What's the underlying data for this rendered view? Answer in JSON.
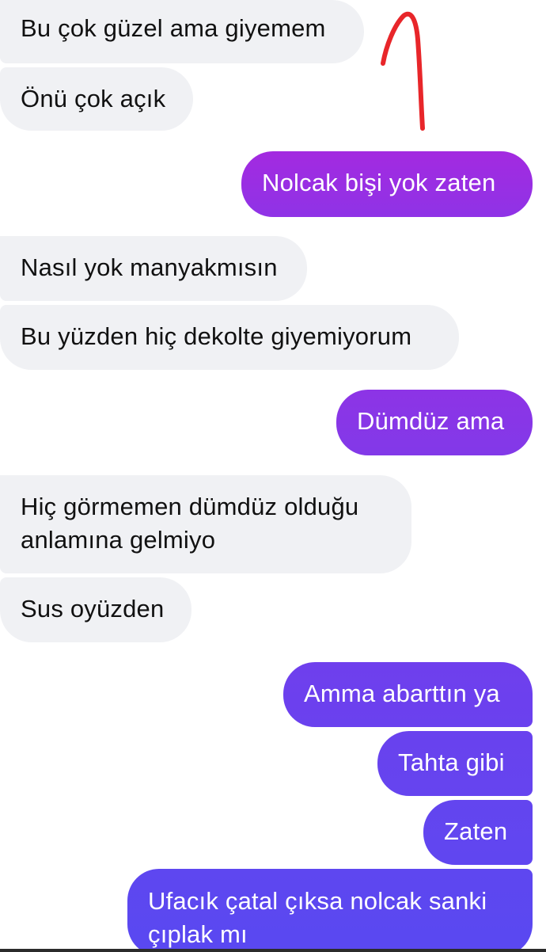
{
  "conversation": {
    "messages": [
      {
        "text": "Bu çok güzel ama giyemem",
        "sender": "other"
      },
      {
        "text": "Önü çok açık",
        "sender": "other"
      },
      {
        "text": "Nolcak bişi yok zaten",
        "sender": "me"
      },
      {
        "text": "Nasıl yok manyakmısın",
        "sender": "other"
      },
      {
        "text": "Bu yüzden hiç dekolte giyemiyorum",
        "sender": "other"
      },
      {
        "text": "Dümdüz ama",
        "sender": "me"
      },
      {
        "text": "Hiç görmemen dümdüz olduğu",
        "text_line2": "anlamına gelmiyo",
        "sender": "other"
      },
      {
        "text": "Sus oyüzden",
        "sender": "other"
      },
      {
        "text": "Amma abarttın ya",
        "sender": "me"
      },
      {
        "text": "Tahta gibi",
        "sender": "me"
      },
      {
        "text": "Zaten",
        "sender": "me"
      },
      {
        "text": "Ufacık çatal çıksa nolcak sanki",
        "text_line2": "çıplak mı",
        "sender": "me"
      }
    ]
  },
  "annotation": {
    "shape": "hand-drawn red arrow pointing up",
    "color": "#e8262a"
  },
  "colors": {
    "incoming_bubble": "#f0f1f4",
    "outgoing_gradient_top": "#9b2fe0",
    "outgoing_gradient_bottom": "#5a47f0",
    "outgoing_text": "#ffffff",
    "incoming_text": "#111111"
  }
}
